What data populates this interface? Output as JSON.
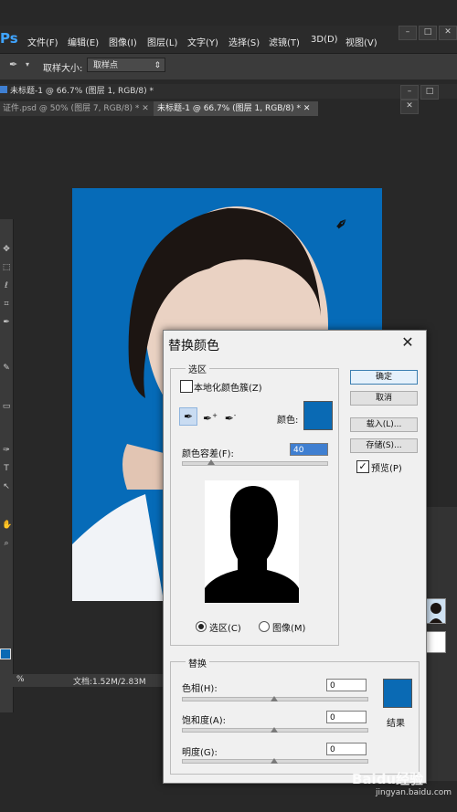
{
  "app": {
    "logo": "Ps"
  },
  "menu": [
    "文件(F)",
    "编辑(E)",
    "图像(I)",
    "图层(L)",
    "文字(Y)",
    "选择(S)",
    "滤镜(T)",
    "3D(D)",
    "视图(V)"
  ],
  "options": {
    "sample_label": "取样大小:",
    "sample_value": "取样点"
  },
  "docs": {
    "active_title": "未标题-1 @ 66.7% (图层 1, RGB/8) *",
    "tab1": "证件.psd @ 50% (图层 7, RGB/8) *",
    "tab2": "未标题-1 @ 66.7% (图层 1, RGB/8) *"
  },
  "status": {
    "zoom": "%",
    "doc_size": "文档:1.52M/2.83M"
  },
  "dialog": {
    "title": "替换颜色",
    "selection_group": "选区",
    "localized_label": "本地化颜色簇(Z)",
    "color_label": "颜色:",
    "fuzziness_label": "颜色容差(F):",
    "fuzziness_value": "40",
    "radio_selection": "选区(C)",
    "radio_image": "图像(M)",
    "replace_group": "替换",
    "hue_label": "色相(H):",
    "hue_value": "0",
    "saturation_label": "饱和度(A):",
    "saturation_value": "0",
    "lightness_label": "明度(G):",
    "lightness_value": "0",
    "result_label": "结果",
    "btn_ok": "确定",
    "btn_cancel": "取消",
    "btn_load": "载入(L)...",
    "btn_save": "存储(S)...",
    "preview_label": "预览(P)",
    "fuzziness_level": 0.2,
    "hue_level": 0.5,
    "saturation_level": 0.5,
    "lightness_level": 0.5
  },
  "colors": {
    "selected": "#0a6ab4",
    "result": "#0a6ab4",
    "photo_bg": "#066bb8"
  },
  "watermark": {
    "brand": "Bai&#x1F43E;经验",
    "brand_text": "Baidu经验",
    "url": "jingyan.baidu.com"
  }
}
